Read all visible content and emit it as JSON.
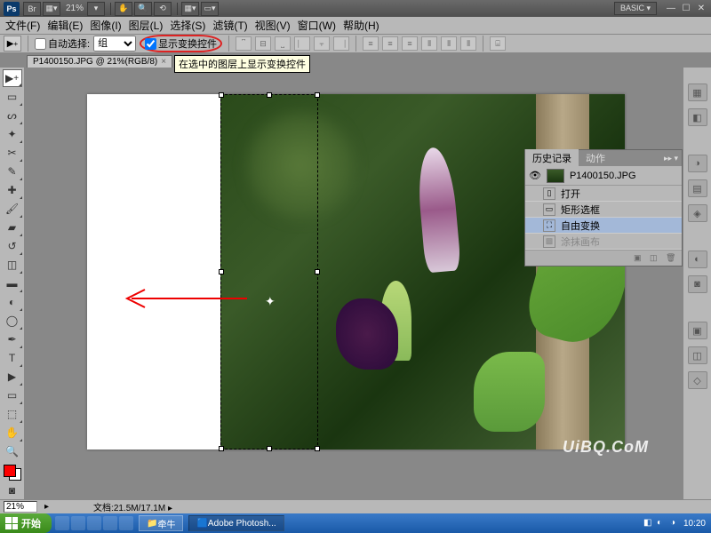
{
  "titlebar": {
    "ps_label": "Ps",
    "br_label": "Br",
    "zoom_display": "21%",
    "workspace_preset": "BASIC"
  },
  "menus": {
    "file": "文件(F)",
    "edit": "编辑(E)",
    "image": "图像(I)",
    "layer": "图层(L)",
    "select": "选择(S)",
    "filter": "滤镜(T)",
    "view": "视图(V)",
    "window": "窗口(W)",
    "help": "帮助(H)"
  },
  "options": {
    "auto_select_label": "自动选择:",
    "group_options": [
      "组"
    ],
    "group_selected": "组",
    "show_transform_label": "显示变换控件",
    "tooltip_text": "在选中的图层上显示变换控件"
  },
  "document": {
    "tab_title": "P1400150.JPG @ 21%(RGB/8)",
    "filename": "P1400150.JPG"
  },
  "history_panel": {
    "tab_history": "历史记录",
    "tab_actions": "动作",
    "items": [
      {
        "icon": "open",
        "label": "打开"
      },
      {
        "icon": "marquee",
        "label": "矩形选框"
      },
      {
        "icon": "transform",
        "label": "自由变换"
      },
      {
        "icon": "fill",
        "label": "涂抹画布"
      }
    ]
  },
  "statusbar": {
    "zoom": "21%",
    "doc_info_label": "文档:",
    "doc_info_value": "21.5M/17.1M"
  },
  "taskbar": {
    "start": "开始",
    "task1": "牵牛",
    "task2": "Adobe Photosh...",
    "time": "10:20"
  },
  "watermark": "UiBQ.CoM"
}
